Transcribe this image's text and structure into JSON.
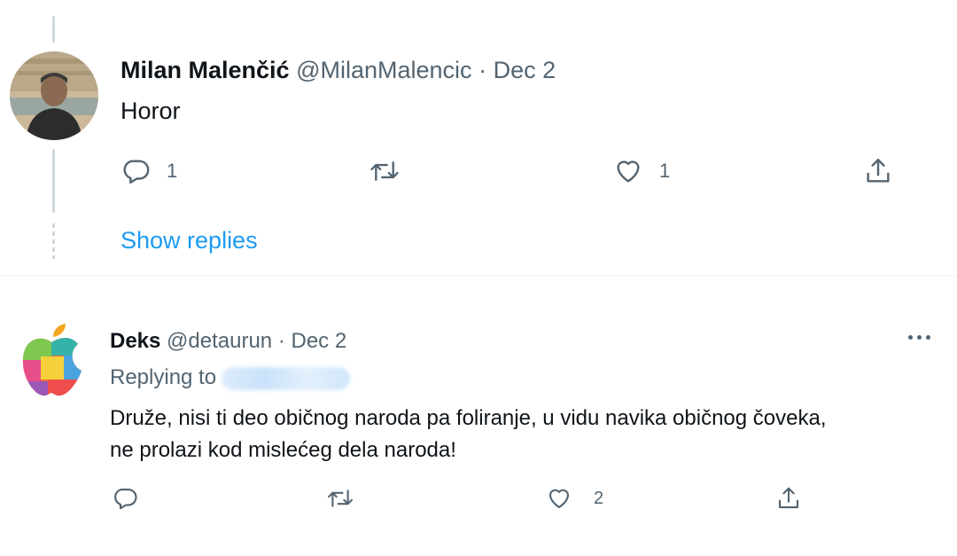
{
  "tweet1": {
    "display_name": "Milan Malenčić",
    "handle": "@MilanMalencic",
    "separator": "·",
    "date": "Dec 2",
    "text": "Horor",
    "reply_count": "1",
    "like_count": "1",
    "icons": [
      "comment-icon",
      "retweet-icon",
      "heart-icon",
      "share-icon"
    ]
  },
  "show_replies_label": "Show replies",
  "tweet2": {
    "display_name": "Deks",
    "handle": "@detaurun",
    "separator": "·",
    "date": "Dec 2",
    "replying_to_label": "Replying to",
    "text_line1": "Druže, nisi ti deo običnog naroda pa foliranje, u vidu navika običnog čoveka,",
    "text_line2": "ne prolazi kod mislećeg dela naroda!",
    "like_count": "2",
    "icons": [
      "comment-icon",
      "retweet-icon",
      "heart-icon",
      "share-icon",
      "more-icon"
    ]
  },
  "colors": {
    "link": "#1d9bf0",
    "muted": "#536471",
    "text": "#0f1419",
    "thread": "#cfd9de"
  }
}
